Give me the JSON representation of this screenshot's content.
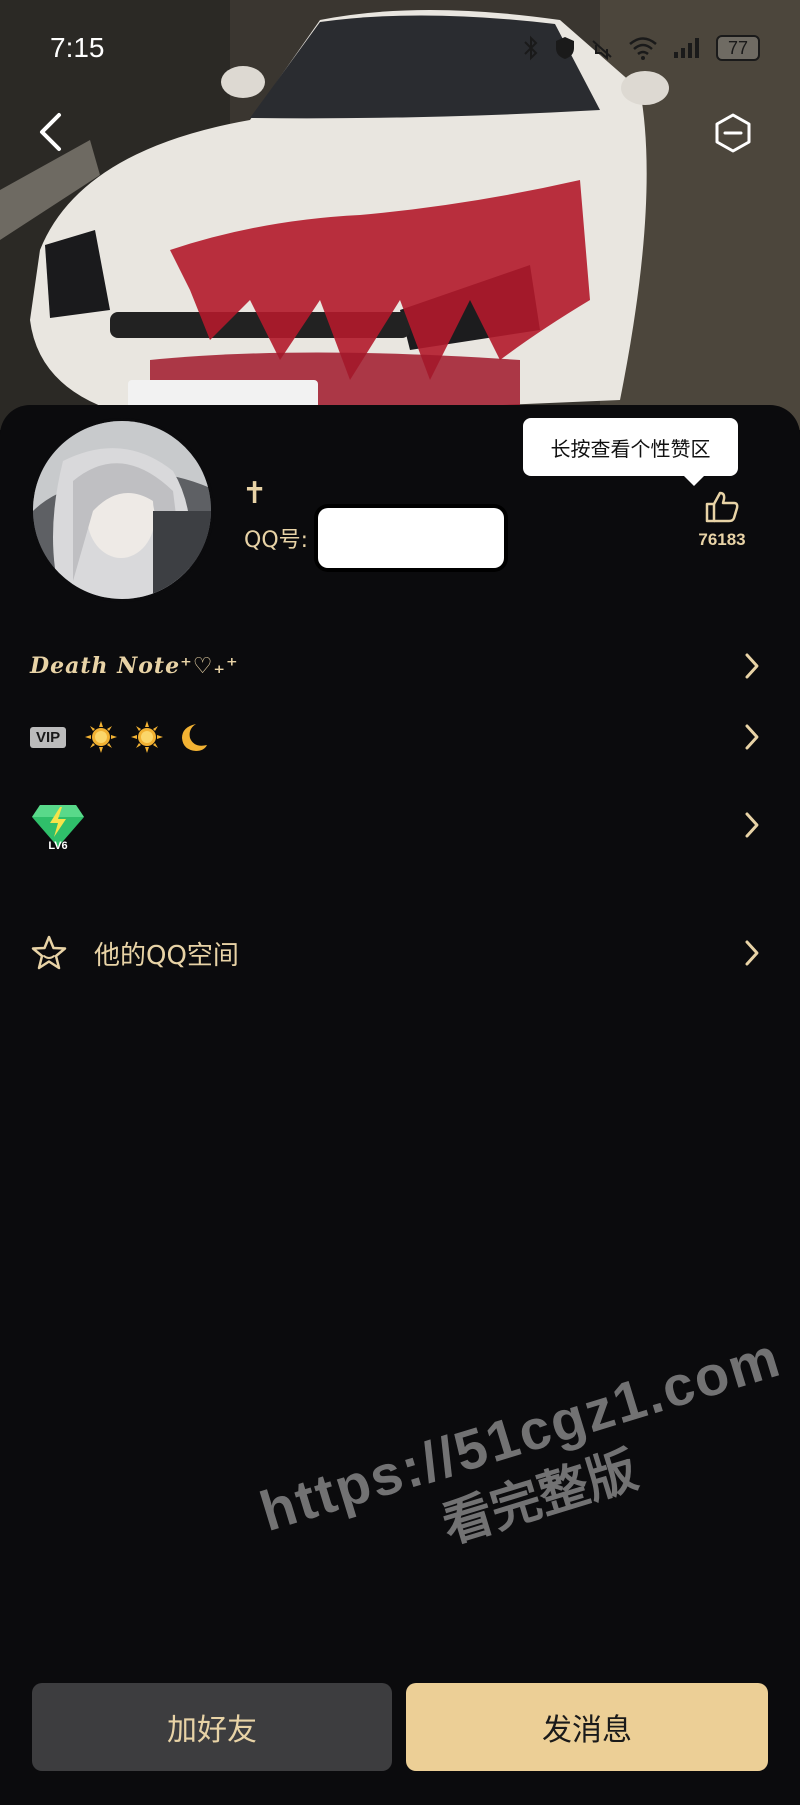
{
  "status_bar": {
    "time": "7:15",
    "battery": "77",
    "icons": [
      "bluetooth-icon",
      "shield-icon",
      "mute-icon",
      "wifi-icon",
      "signal-icon",
      "battery-icon"
    ]
  },
  "header": {
    "back_icon": "chevron-left-icon",
    "more_icon": "minus-circle-icon"
  },
  "profile": {
    "name": "✝",
    "qq_label": "QQ号:",
    "like_tooltip": "长按查看个性赞区",
    "like_count": "76183"
  },
  "rows": {
    "signature": "Death Note⁺♡₊⁺",
    "vip_label": "VIP",
    "vip_icons": [
      "sun-icon",
      "sun-icon",
      "moon-icon"
    ],
    "level_label": "LV6",
    "qzone_label": "他的QQ空间"
  },
  "watermark": {
    "url": "https://51cgz1.com",
    "text": "看完整版"
  },
  "buttons": {
    "add_friend": "加好友",
    "send_message": "发消息"
  },
  "colors": {
    "background": "#0b0b0d",
    "accent_gold": "#e8d3a6",
    "primary_button": "#eccf96",
    "secondary_button": "#3d3d3f"
  }
}
